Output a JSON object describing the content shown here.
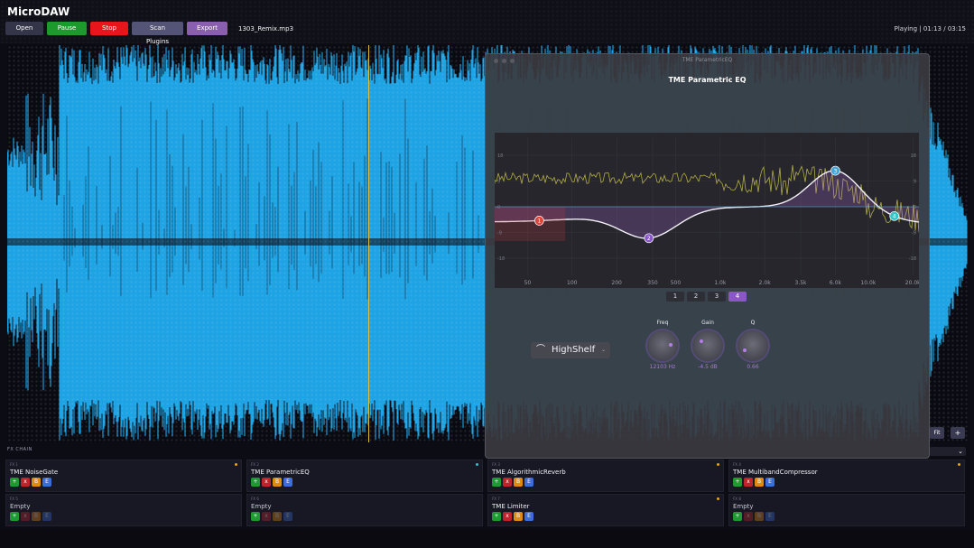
{
  "app": {
    "title": "MicroDAW"
  },
  "toolbar": {
    "open_label": "Open",
    "pause_label": "Pause",
    "stop_label": "Stop",
    "scan_label": "Scan Plugins",
    "export_label": "Export",
    "file_name": "1303_Remix.mp3"
  },
  "status": {
    "text": "Playing  |  01:13 / 03:15"
  },
  "view": {
    "fit_label": "Fit",
    "plus_label": "+"
  },
  "fx": {
    "label": "FX CHAIN",
    "collapse_icon": "chevron-down-icon",
    "slots": [
      {
        "num": "FX 1",
        "name": "TME NoiseGate",
        "enabled": true,
        "led": "#e7a21a"
      },
      {
        "num": "FX 2",
        "name": "TME ParametricEQ",
        "enabled": true,
        "led": "#3fb8c8"
      },
      {
        "num": "FX 3",
        "name": "TME AlgorithmicReverb",
        "enabled": true,
        "led": "#e7a21a"
      },
      {
        "num": "FX 4",
        "name": "TME MultibandCompressor",
        "enabled": true,
        "led": "#e7a21a"
      },
      {
        "num": "FX 5",
        "name": "Empty",
        "enabled": false,
        "led": ""
      },
      {
        "num": "FX 6",
        "name": "Empty",
        "enabled": false,
        "led": ""
      },
      {
        "num": "FX 7",
        "name": "TME Limiter",
        "enabled": true,
        "led": "#e7a21a"
      },
      {
        "num": "FX 8",
        "name": "Empty",
        "enabled": false,
        "led": ""
      }
    ],
    "button_labels": {
      "add": "+",
      "remove": "x",
      "bypass": "B",
      "edit": "E"
    }
  },
  "plugin": {
    "window_title": "TME ParametricEQ",
    "heading": "TME Parametric EQ",
    "freq_labels": [
      "50",
      "100",
      "200",
      "350",
      "500",
      "1.0k",
      "2.0k",
      "3.5k",
      "6.0k",
      "10.0k",
      "20.0k"
    ],
    "db_labels": [
      "18",
      "9",
      "0",
      "-9",
      "-18"
    ],
    "bands": [
      {
        "id": "1",
        "freq_hz": 60,
        "gain_db": -12,
        "color": "#e0443b"
      },
      {
        "id": "2",
        "freq_hz": 330,
        "gain_db": -13,
        "color": "#8957c8"
      },
      {
        "id": "3",
        "freq_hz": 6000,
        "gain_db": 14,
        "color": "#3fa8d8"
      },
      {
        "id": "4",
        "freq_hz": 15000,
        "gain_db": -9,
        "color": "#2fc7c7"
      }
    ],
    "band_tabs": [
      "1",
      "2",
      "3",
      "4"
    ],
    "active_band": "4",
    "filter_type": "HighShelf",
    "filter_icon": "shelf-curve-icon",
    "knobs": [
      {
        "label": "Freq",
        "value": "12103 Hz"
      },
      {
        "label": "Gain",
        "value": "-4.5 dB"
      },
      {
        "label": "Q",
        "value": "0.66"
      }
    ]
  },
  "colors": {
    "waveform": "#1ea3e4",
    "playhead": "#e1c23a",
    "accent": "#8957c8"
  }
}
